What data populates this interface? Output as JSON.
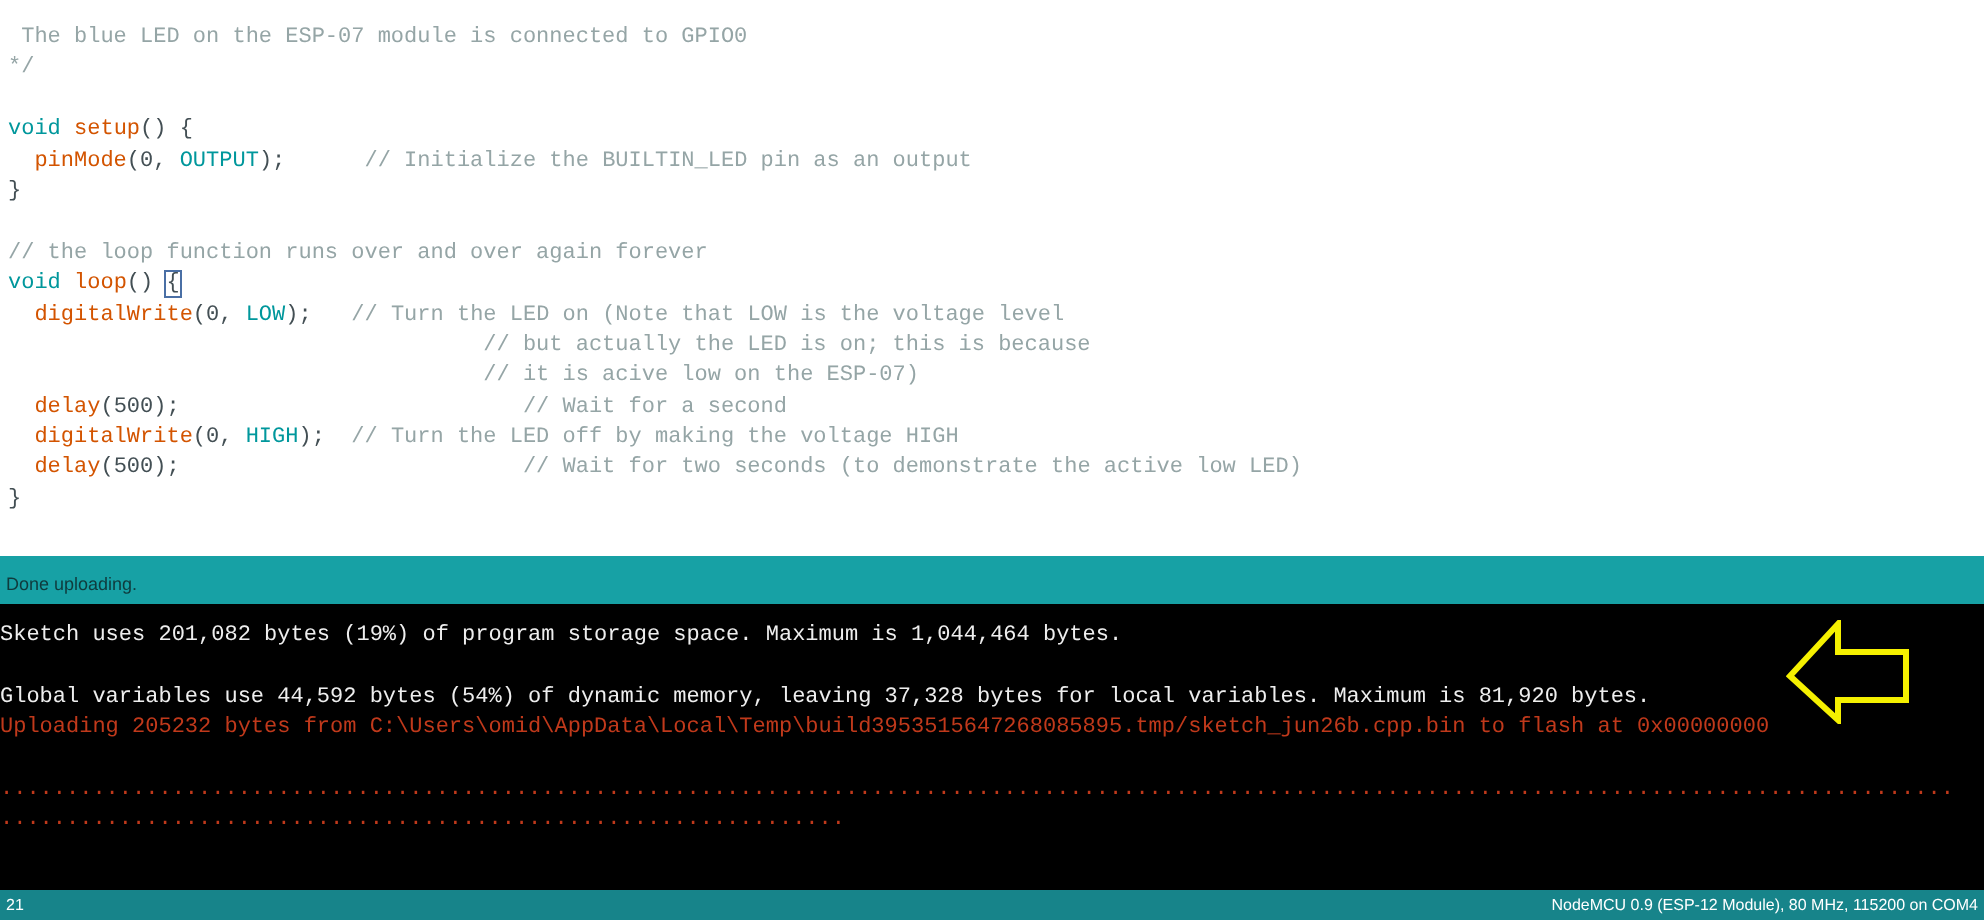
{
  "editor": {
    "lines": [
      {
        "segments": [
          {
            "kind": "comment",
            "text": " The blue LED on the ESP-07 module is connected to GPIO0"
          }
        ]
      },
      {
        "segments": [
          {
            "kind": "comment",
            "text": "*/"
          }
        ]
      },
      {
        "blank_before": true,
        "segments": [
          {
            "kind": "keyword",
            "text": "void "
          },
          {
            "kind": "function",
            "text": "setup"
          },
          {
            "kind": "plain",
            "text": "() {"
          }
        ]
      },
      {
        "segments": [
          {
            "kind": "function",
            "text": "  pinMode"
          },
          {
            "kind": "plain",
            "text": "(0, "
          },
          {
            "kind": "constant",
            "text": "OUTPUT"
          },
          {
            "kind": "plain",
            "text": ");      "
          },
          {
            "kind": "comment",
            "text": "// Initialize the BUILTIN_LED pin as an output"
          }
        ]
      },
      {
        "segments": [
          {
            "kind": "plain",
            "text": "}"
          }
        ]
      },
      {
        "blank_before": true,
        "segments": [
          {
            "kind": "comment",
            "text": "// the loop function runs over and over again forever"
          }
        ]
      },
      {
        "segments": [
          {
            "kind": "keyword",
            "text": "void "
          },
          {
            "kind": "function",
            "text": "loop"
          },
          {
            "kind": "plain",
            "text": "() "
          },
          {
            "kind": "bracket_match",
            "text": "{"
          }
        ]
      },
      {
        "segments": [
          {
            "kind": "function",
            "text": "  digitalWrite"
          },
          {
            "kind": "plain",
            "text": "(0, "
          },
          {
            "kind": "constant",
            "text": "LOW"
          },
          {
            "kind": "plain",
            "text": ");   "
          },
          {
            "kind": "comment",
            "text": "// Turn the LED on (Note that LOW is the voltage level"
          }
        ]
      },
      {
        "segments": [
          {
            "kind": "comment",
            "text": "                                    // but actually the LED is on; this is because"
          }
        ]
      },
      {
        "segments": [
          {
            "kind": "comment",
            "text": "                                    // it is acive low on the ESP-07)"
          }
        ]
      },
      {
        "segments": [
          {
            "kind": "function",
            "text": "  delay"
          },
          {
            "kind": "plain",
            "text": "(500);                          "
          },
          {
            "kind": "comment",
            "text": "// Wait for a second"
          }
        ]
      },
      {
        "segments": [
          {
            "kind": "function",
            "text": "  digitalWrite"
          },
          {
            "kind": "plain",
            "text": "(0, "
          },
          {
            "kind": "constant",
            "text": "HIGH"
          },
          {
            "kind": "plain",
            "text": ");  "
          },
          {
            "kind": "comment",
            "text": "// Turn the LED off by making the voltage HIGH"
          }
        ]
      },
      {
        "segments": [
          {
            "kind": "function",
            "text": "  delay"
          },
          {
            "kind": "plain",
            "text": "(500);                          "
          },
          {
            "kind": "comment",
            "text": "// Wait for two seconds (to demonstrate the active low LED)"
          }
        ]
      },
      {
        "segments": [
          {
            "kind": "plain",
            "text": "}"
          }
        ]
      }
    ]
  },
  "status": {
    "message": "Done uploading."
  },
  "console": {
    "lines": [
      {
        "kind": "info",
        "text": "Sketch uses 201,082 bytes (19%) of program storage space. Maximum is 1,044,464 bytes."
      },
      {
        "kind": "info",
        "blank_before": true,
        "text": "Global variables use 44,592 bytes (54%) of dynamic memory, leaving 37,328 bytes for local variables. Maximum is 81,920 bytes."
      },
      {
        "kind": "error",
        "text": "Uploading 205232 bytes from C:\\Users\\omid\\AppData\\Local\\Temp\\build3953515647268085895.tmp/sketch_jun26b.cpp.bin to flash at 0x00000000"
      },
      {
        "kind": "error",
        "blank_before": true,
        "text": "...................................................................................................................................................."
      },
      {
        "kind": "error",
        "text": "................................................................"
      }
    ]
  },
  "footer": {
    "line_number": "21",
    "board": "NodeMCU 0.9 (ESP-12 Module), 80 MHz, 115200 on COM4"
  }
}
